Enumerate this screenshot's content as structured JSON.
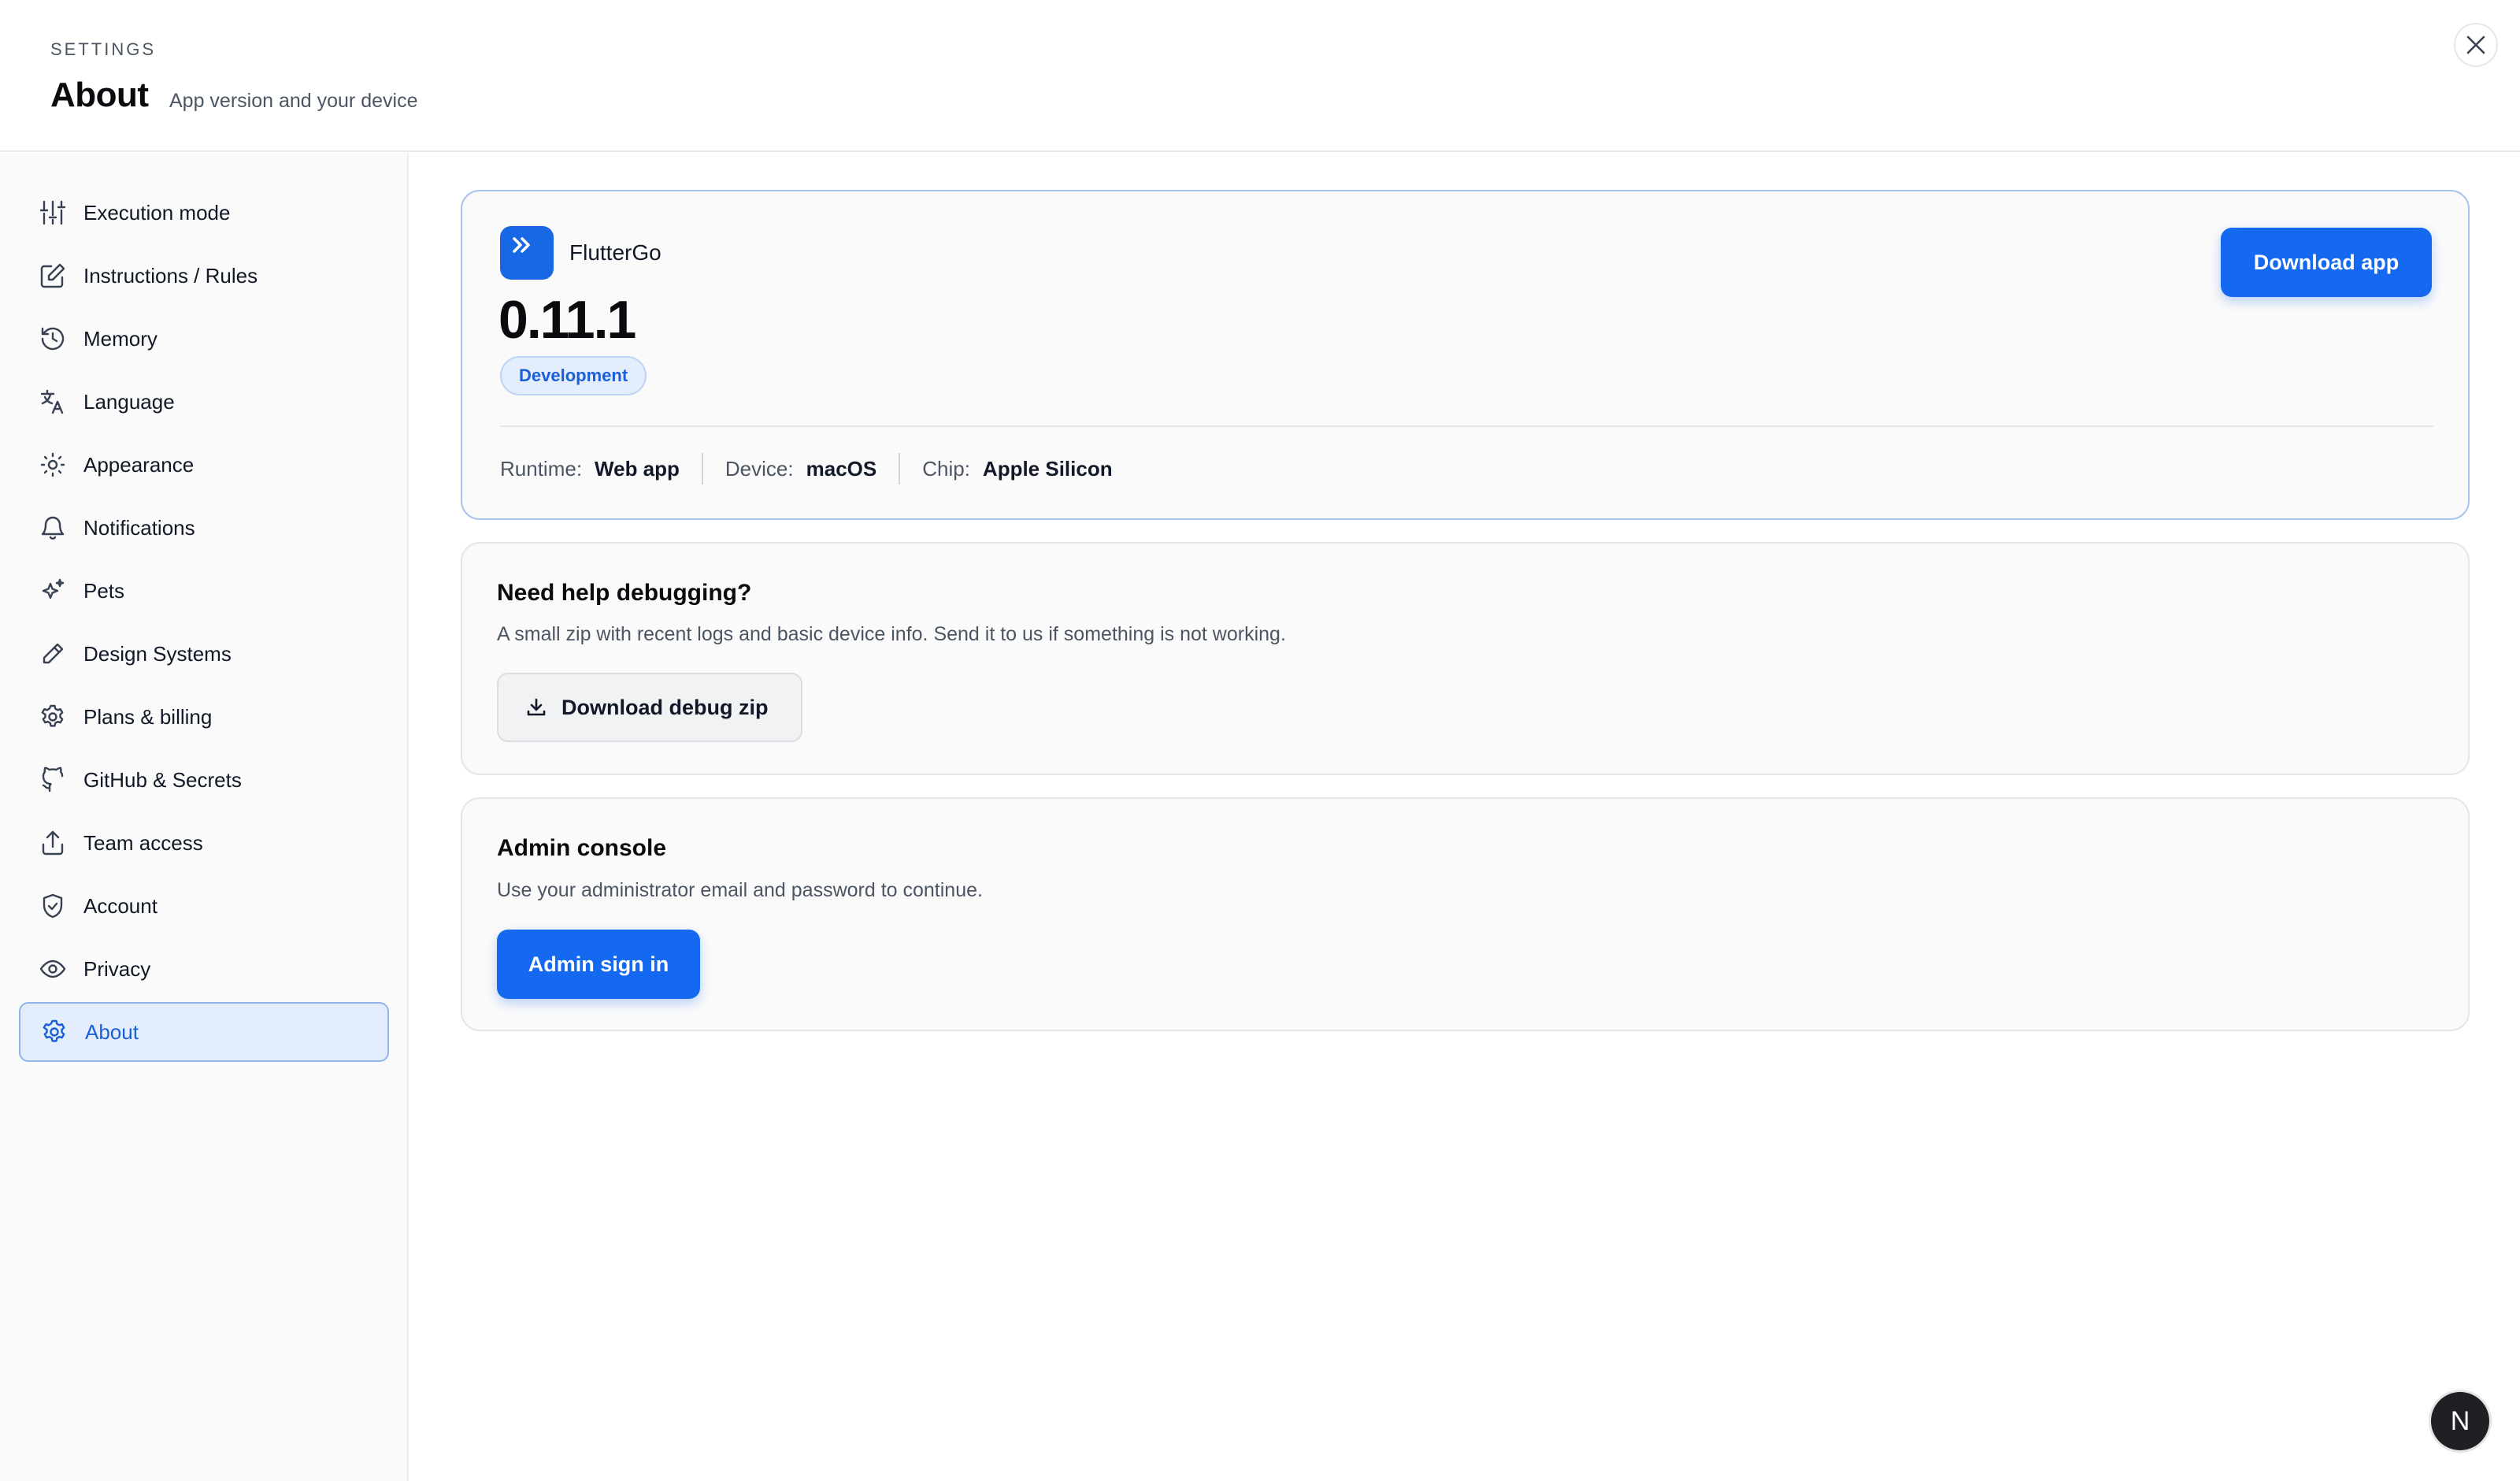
{
  "header": {
    "eyebrow": "SETTINGS",
    "title": "About",
    "subtitle": "App version and your device"
  },
  "sidebar": {
    "items": [
      {
        "label": "Execution mode",
        "icon": "sliders-icon"
      },
      {
        "label": "Instructions / Rules",
        "icon": "edit-icon"
      },
      {
        "label": "Memory",
        "icon": "history-icon"
      },
      {
        "label": "Language",
        "icon": "translate-icon"
      },
      {
        "label": "Appearance",
        "icon": "sun-icon"
      },
      {
        "label": "Notifications",
        "icon": "bell-icon"
      },
      {
        "label": "Pets",
        "icon": "sparkles-icon"
      },
      {
        "label": "Design Systems",
        "icon": "pencil-icon"
      },
      {
        "label": "Plans & billing",
        "icon": "gear-icon"
      },
      {
        "label": "GitHub & Secrets",
        "icon": "github-icon"
      },
      {
        "label": "Team access",
        "icon": "share-icon"
      },
      {
        "label": "Account",
        "icon": "shield-icon"
      },
      {
        "label": "Privacy",
        "icon": "eye-icon"
      },
      {
        "label": "About",
        "icon": "gear-icon",
        "active": true
      }
    ]
  },
  "app_card": {
    "app_name": "FlutterGo",
    "version": "0.11.1",
    "badge": "Development",
    "download_label": "Download app",
    "meta": [
      {
        "key": "Runtime:",
        "value": "Web app"
      },
      {
        "key": "Device:",
        "value": "macOS"
      },
      {
        "key": "Chip:",
        "value": "Apple Silicon"
      }
    ]
  },
  "debug_card": {
    "title": "Need help debugging?",
    "description": "A small zip with recent logs and basic device info. Send it to us if something is not working.",
    "button_label": "Download debug zip"
  },
  "admin_card": {
    "title": "Admin console",
    "description": "Use your administrator email and password to continue.",
    "button_label": "Admin sign in"
  },
  "avatar": {
    "initial": "N"
  },
  "colors": {
    "accent": "#1469f0",
    "active_bg": "#e3edfb",
    "active_border": "#8fb5ec"
  }
}
